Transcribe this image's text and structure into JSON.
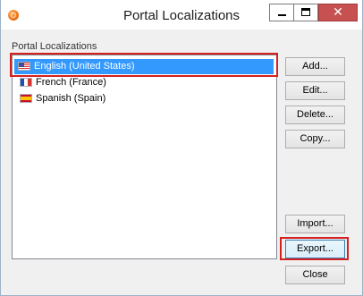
{
  "window": {
    "title": "Portal Localizations",
    "controls": {
      "minimize": "minimize",
      "maximize": "maximize",
      "close": "x"
    }
  },
  "localizations": {
    "group_label": "Portal Localizations",
    "items": [
      {
        "label": "English (United States)",
        "flag": "us-flag-icon",
        "selected": true
      },
      {
        "label": "French (France)",
        "flag": "france-flag-icon",
        "selected": false
      },
      {
        "label": "Spanish (Spain)",
        "flag": "spain-flag-icon",
        "selected": false
      }
    ]
  },
  "buttons": {
    "add": "Add...",
    "edit": "Edit...",
    "delete": "Delete...",
    "copy": "Copy...",
    "import": "Import...",
    "export": "Export...",
    "close": "Close"
  },
  "colors": {
    "selection": "#3399ff",
    "highlight_annotation": "#d62020",
    "close_button": "#c75050"
  }
}
